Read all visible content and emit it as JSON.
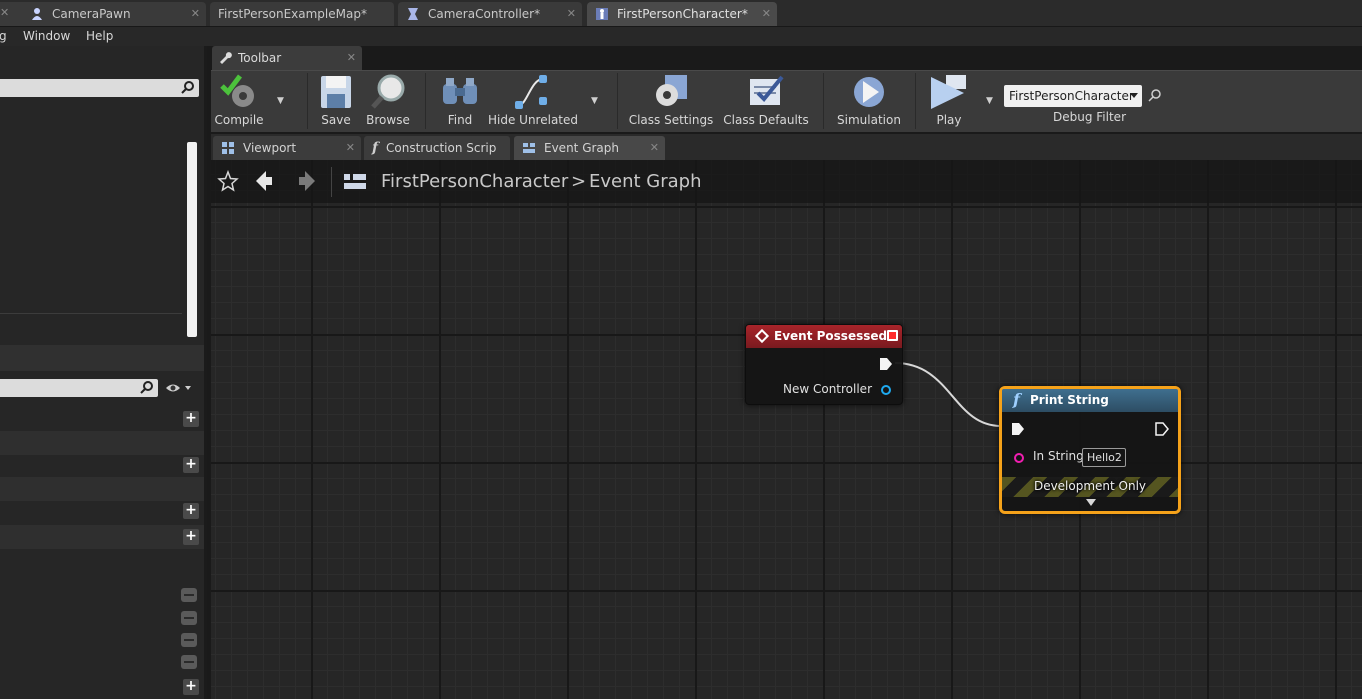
{
  "tabs": [
    {
      "label": "CameraPawn",
      "active": false
    },
    {
      "label": "FirstPersonExampleMap*",
      "active": false
    },
    {
      "label": "CameraController*",
      "active": false
    },
    {
      "label": "FirstPersonCharacter*",
      "active": true
    }
  ],
  "menu": {
    "partial": "g",
    "window": "Window",
    "help": "Help"
  },
  "toolbar": {
    "tab_label": "Toolbar",
    "compile": "Compile",
    "save": "Save",
    "browse": "Browse",
    "find": "Find",
    "hide_unrelated": "Hide Unrelated",
    "class_settings": "Class Settings",
    "class_defaults": "Class Defaults",
    "simulation": "Simulation",
    "play": "Play",
    "debug_filter_value": "FirstPersonCharacter",
    "debug_filter_label": "Debug Filter"
  },
  "editor_tabs": [
    {
      "label": "Viewport",
      "icon": "viewport-icon"
    },
    {
      "label": "Construction Scrip",
      "icon": "function-icon"
    },
    {
      "label": "Event Graph",
      "icon": "graph-icon",
      "active": true
    }
  ],
  "breadcrumb": {
    "blueprint": "FirstPersonCharacter",
    "separator": ">",
    "graph": "Event Graph"
  },
  "nodes": {
    "event": {
      "title": "Event Possessed",
      "output_pin": "New Controller"
    },
    "print": {
      "title": "Print String",
      "in_string_label": "In String",
      "in_string_value": "Hello2",
      "dev_label": "Development Only"
    }
  },
  "colors": {
    "event_header": "#a8242a",
    "function_header": "#3f6f8f",
    "selection": "#f5a21a",
    "string_pin": "#f01eb0",
    "object_pin": "#1eaaf0"
  }
}
